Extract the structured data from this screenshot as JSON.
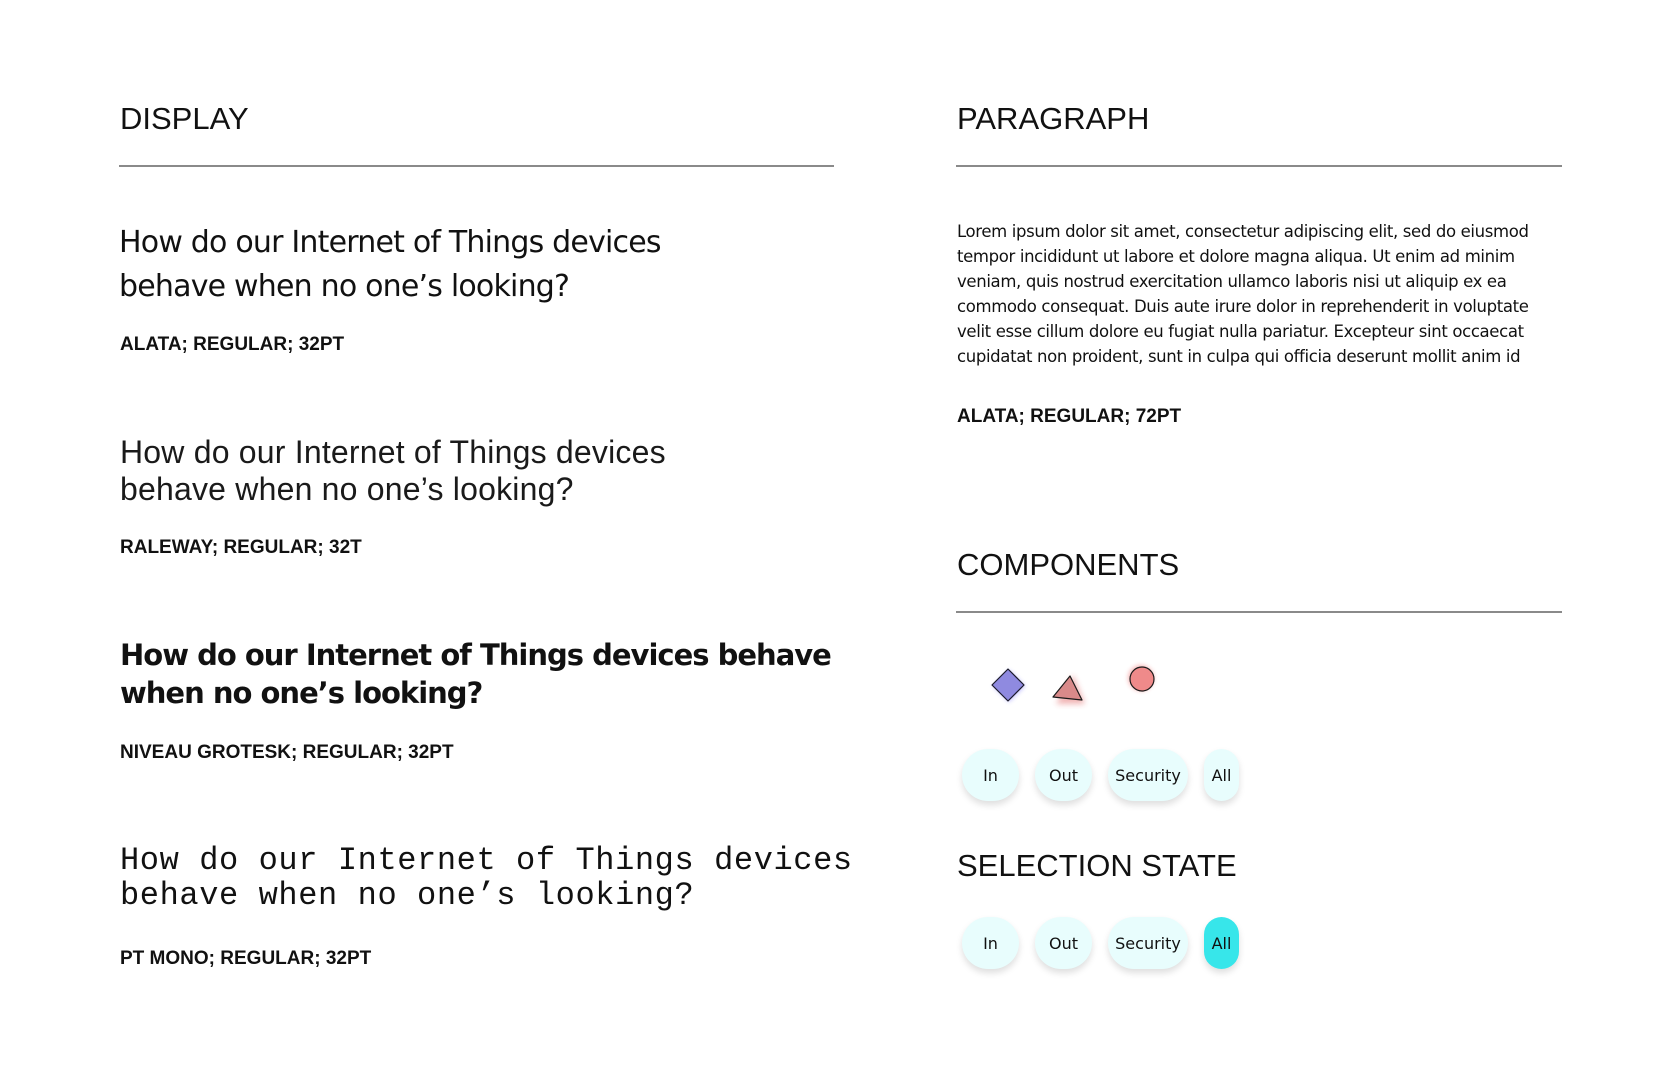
{
  "display": {
    "title": "DISPLAY",
    "samples": [
      {
        "line1": "How do our Internet of Things devices",
        "line2": "behave when no one’s looking?",
        "caption": "ALATA; REGULAR; 32PT"
      },
      {
        "line1": "How do our Internet of Things devices",
        "line2": "behave when no one’s looking?",
        "caption": "RALEWAY; REGULAR; 32T"
      },
      {
        "line1": "How do our Internet of Things devices behave",
        "line2": "when no one’s looking?",
        "caption": "NIVEAU GROTESK; REGULAR; 32PT"
      },
      {
        "line1": "How do our Internet of Things devices",
        "line2": "behave when no one’s looking?",
        "caption": "PT MONO; REGULAR; 32PT"
      }
    ]
  },
  "paragraph": {
    "title": "PARAGRAPH",
    "lines": [
      "Lorem ipsum dolor sit amet, consectetur adipiscing elit, sed do eiusmod",
      "tempor incididunt ut labore et dolore magna aliqua. Ut enim ad minim",
      "veniam, quis nostrud exercitation ullamco laboris nisi ut aliquip ex ea",
      "commodo consequat. Duis aute irure dolor in reprehenderit in voluptate",
      "velit esse cillum dolore eu fugiat nulla pariatur. Excepteur sint occaecat",
      "cupidatat non proident, sunt in culpa qui officia deserunt mollit anim id"
    ],
    "caption": "ALATA; REGULAR; 72PT"
  },
  "components": {
    "title": "COMPONENTS",
    "icons": [
      {
        "name": "diamond-icon",
        "color": "#8f8ae0"
      },
      {
        "name": "triangle-icon",
        "color": "#d98a8a"
      },
      {
        "name": "circle-icon",
        "color": "#ef8a8a"
      }
    ],
    "filters": [
      "In",
      "Out",
      "Security",
      "All"
    ]
  },
  "selection_state": {
    "title": "SELECTION STATE",
    "filters": [
      "In",
      "Out",
      "Security",
      "All"
    ],
    "selected": "All",
    "selected_color": "#37e6ea",
    "pill_color": "#e8fdfd"
  }
}
